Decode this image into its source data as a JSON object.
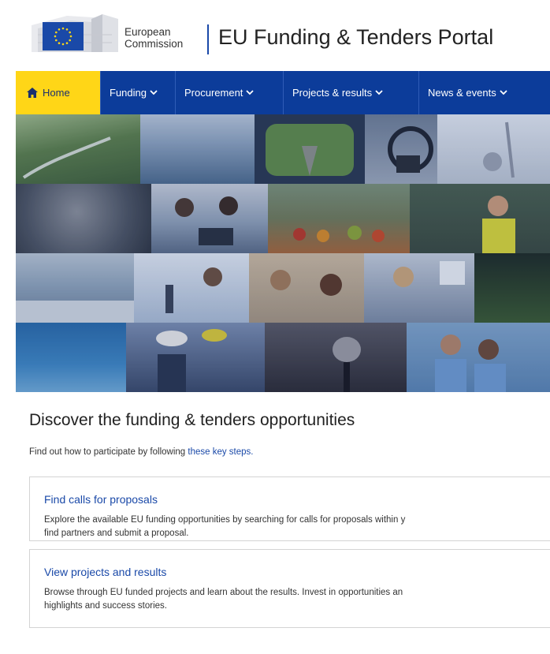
{
  "header": {
    "org_line1": "European",
    "org_line2": "Commission",
    "portal_title": "EU Funding & Tenders Portal"
  },
  "nav": {
    "items": [
      {
        "label": "Home",
        "icon": "home-icon",
        "active": true
      },
      {
        "label": "Funding",
        "dropdown": true
      },
      {
        "label": "Procurement",
        "dropdown": true
      },
      {
        "label": "Projects & results",
        "dropdown": true
      },
      {
        "label": "News & events",
        "dropdown": true
      }
    ],
    "colors": {
      "bar": "#0c3c9a",
      "active": "#ffd617"
    }
  },
  "content": {
    "title": "Discover the funding & tenders opportunities",
    "intro_text": "Find out how to participate by following ",
    "intro_link": "these key steps.",
    "cards": [
      {
        "title": "Find calls for proposals",
        "desc_line1": "Explore the available EU funding opportunities by searching for calls for proposals within y",
        "desc_line2": "find partners and submit a proposal."
      },
      {
        "title": "View projects and results",
        "desc_line1": "Browse through EU funded projects and learn about the results. Invest in opportunities an",
        "desc_line2": "highlights and success stories."
      }
    ]
  }
}
